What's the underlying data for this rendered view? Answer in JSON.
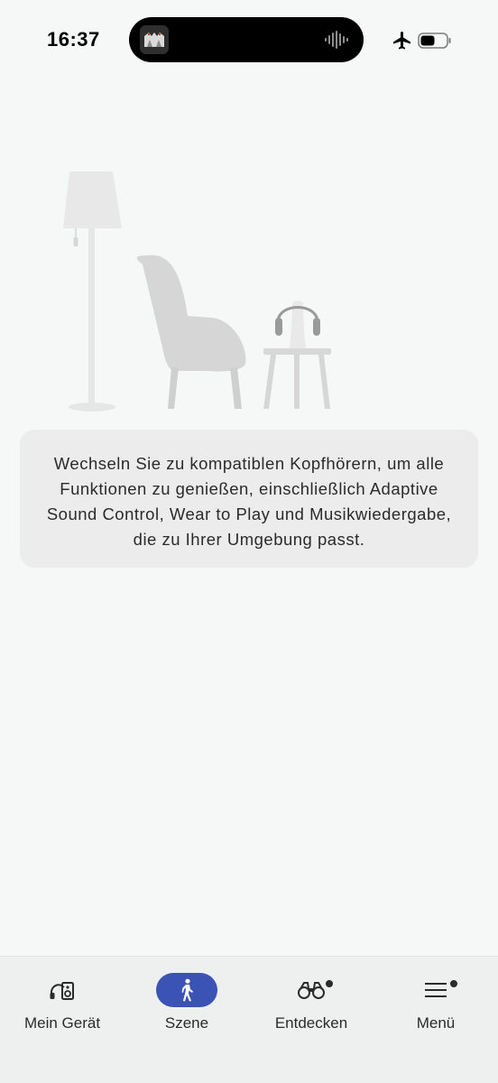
{
  "status_bar": {
    "time": "16:37",
    "icons": [
      "app-album-art-icon",
      "audio-waveform-icon",
      "airplane-mode-icon",
      "battery-icon"
    ]
  },
  "illustration": {
    "icons": [
      "floor-lamp-icon",
      "armchair-icon",
      "side-table-icon",
      "headphones-icon"
    ]
  },
  "info_card": {
    "text": "Wechseln Sie zu kompatiblen Kopfhörern, um alle Funktionen zu genießen, einschließlich Adaptive Sound Control, Wear to Play und Musikwiedergabe, die zu Ihrer Umgebung passt."
  },
  "bottom_nav": {
    "active": "Szene",
    "accent_color": "#3a53b4",
    "items": [
      {
        "label": "Mein Gerät",
        "icon": "headphones-speaker-icon",
        "badge": false
      },
      {
        "label": "Szene",
        "icon": "walking-person-icon",
        "badge": false
      },
      {
        "label": "Entdecken",
        "icon": "binoculars-icon",
        "badge": true
      },
      {
        "label": "Menü",
        "icon": "hamburger-menu-icon",
        "badge": true
      }
    ]
  }
}
